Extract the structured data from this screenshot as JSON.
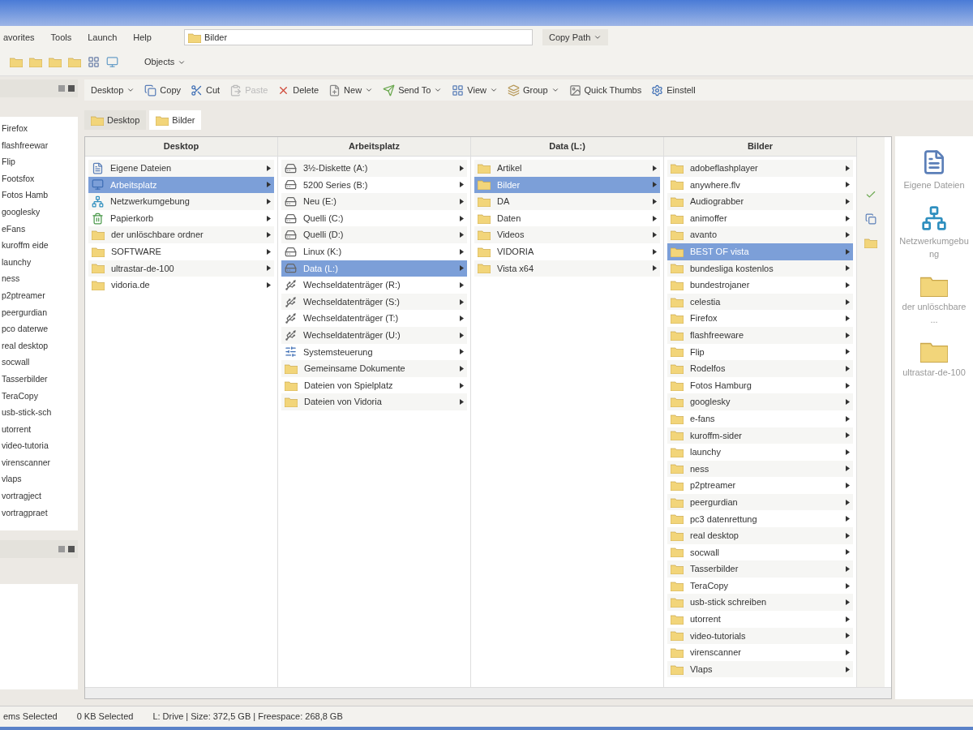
{
  "menu": [
    "avorites",
    "Tools",
    "Launch",
    "Help"
  ],
  "address": {
    "value": "Bilder"
  },
  "copy_path": "Copy Path",
  "toolbar": {
    "objects": "Objects"
  },
  "left_tree": [
    "Firefox",
    "flashfreewar",
    "Flip",
    "Footsfox",
    "Fotos Hamb",
    "googlesky",
    "eFans",
    "kuroffm eide",
    "launchy",
    "ness",
    "p2ptreamer",
    "peergurdian",
    "pco daterwe",
    "real desktop",
    "socwall",
    "Tasserbilder",
    "TeraCopy",
    "usb-stick-sch",
    "utorrent",
    "video-tutoria",
    "virenscanner",
    "vlaps",
    "vortragject",
    "vortragpraet"
  ],
  "actions": [
    {
      "label": "Desktop",
      "kind": "dropdown",
      "disabled": false
    },
    {
      "label": "Copy",
      "kind": "copy",
      "disabled": false
    },
    {
      "label": "Cut",
      "kind": "cut",
      "disabled": false
    },
    {
      "label": "Paste",
      "kind": "paste",
      "disabled": true
    },
    {
      "label": "Delete",
      "kind": "delete",
      "disabled": false
    },
    {
      "label": "New",
      "kind": "new",
      "disabled": false
    },
    {
      "label": "Send To",
      "kind": "send",
      "disabled": false
    },
    {
      "label": "View",
      "kind": "view",
      "disabled": false
    },
    {
      "label": "Group",
      "kind": "group",
      "disabled": false
    },
    {
      "label": "Quick Thumbs",
      "kind": "thumbs",
      "disabled": false
    },
    {
      "label": "Einstell",
      "kind": "settings",
      "disabled": false
    }
  ],
  "tabs": [
    {
      "label": "Desktop",
      "selected": false
    },
    {
      "label": "Bilder",
      "selected": true
    }
  ],
  "columns": [
    {
      "title": "Desktop",
      "items": [
        {
          "label": "Eigene Dateien",
          "kind": "documents",
          "selected": false
        },
        {
          "label": "Arbeitsplatz",
          "kind": "computer",
          "selected": true
        },
        {
          "label": "Netzwerkumgebung",
          "kind": "network",
          "selected": false
        },
        {
          "label": "Papierkorb",
          "kind": "trash",
          "selected": false
        },
        {
          "label": "der unlöschbare ordner",
          "kind": "folder",
          "selected": false
        },
        {
          "label": "SOFTWARE",
          "kind": "folder",
          "selected": false
        },
        {
          "label": "ultrastar-de-100",
          "kind": "folder",
          "selected": false
        },
        {
          "label": "vidoria.de",
          "kind": "folder",
          "selected": false
        }
      ]
    },
    {
      "title": "Arbeitsplatz",
      "items": [
        {
          "label": "3½-Diskette (A:)",
          "kind": "drive",
          "selected": false
        },
        {
          "label": "5200 Series (B:)",
          "kind": "drive",
          "selected": false
        },
        {
          "label": "Neu (E:)",
          "kind": "drive",
          "selected": false
        },
        {
          "label": "Quelli (C:)",
          "kind": "drive",
          "selected": false
        },
        {
          "label": "Quelli (D:)",
          "kind": "drive",
          "selected": false
        },
        {
          "label": "Linux (K:)",
          "kind": "drive",
          "selected": false
        },
        {
          "label": "Data (L:)",
          "kind": "drive",
          "selected": true
        },
        {
          "label": "Wechseldatenträger (R:)",
          "kind": "removable",
          "selected": false
        },
        {
          "label": "Wechseldatenträger (S:)",
          "kind": "removable",
          "selected": false
        },
        {
          "label": "Wechseldatenträger (T:)",
          "kind": "removable",
          "selected": false
        },
        {
          "label": "Wechseldatenträger (U:)",
          "kind": "removable",
          "selected": false
        },
        {
          "label": "Systemsteuerung",
          "kind": "control",
          "selected": false
        },
        {
          "label": "Gemeinsame Dokumente",
          "kind": "folder",
          "selected": false
        },
        {
          "label": "Dateien von Spielplatz",
          "kind": "folder",
          "selected": false
        },
        {
          "label": "Dateien von Vidoria",
          "kind": "folder",
          "selected": false
        }
      ]
    },
    {
      "title": "Data (L:)",
      "items": [
        {
          "label": "Artikel",
          "kind": "folder",
          "selected": false
        },
        {
          "label": "Bilder",
          "kind": "folder",
          "selected": true
        },
        {
          "label": "DA",
          "kind": "folder",
          "selected": false
        },
        {
          "label": "Daten",
          "kind": "folder",
          "selected": false
        },
        {
          "label": "Videos",
          "kind": "folder",
          "selected": false
        },
        {
          "label": "VIDORIA",
          "kind": "folder",
          "selected": false
        },
        {
          "label": "Vista x64",
          "kind": "folder",
          "selected": false
        }
      ]
    },
    {
      "title": "Bilder",
      "items": [
        {
          "label": "adobeflashplayer",
          "kind": "folder",
          "selected": false
        },
        {
          "label": "anywhere.flv",
          "kind": "folder",
          "selected": false
        },
        {
          "label": "Audiograbber",
          "kind": "folder",
          "selected": false
        },
        {
          "label": "animoffer",
          "kind": "folder",
          "selected": false
        },
        {
          "label": "avanto",
          "kind": "folder",
          "selected": false
        },
        {
          "label": "BEST OF vista",
          "kind": "folder",
          "selected": true
        },
        {
          "label": "bundesliga kostenlos",
          "kind": "folder",
          "selected": false
        },
        {
          "label": "bundestrojaner",
          "kind": "folder",
          "selected": false
        },
        {
          "label": "celestia",
          "kind": "folder",
          "selected": false
        },
        {
          "label": "Firefox",
          "kind": "folder",
          "selected": false
        },
        {
          "label": "flashfreeware",
          "kind": "folder",
          "selected": false
        },
        {
          "label": "Flip",
          "kind": "folder",
          "selected": false
        },
        {
          "label": "Rodelfos",
          "kind": "folder",
          "selected": false
        },
        {
          "label": "Fotos Hamburg",
          "kind": "folder",
          "selected": false
        },
        {
          "label": "googlesky",
          "kind": "folder",
          "selected": false
        },
        {
          "label": "e-fans",
          "kind": "folder",
          "selected": false
        },
        {
          "label": "kuroffm-sider",
          "kind": "folder",
          "selected": false
        },
        {
          "label": "launchy",
          "kind": "folder",
          "selected": false
        },
        {
          "label": "ness",
          "kind": "folder",
          "selected": false
        },
        {
          "label": "p2ptreamer",
          "kind": "folder",
          "selected": false
        },
        {
          "label": "peergurdian",
          "kind": "folder",
          "selected": false
        },
        {
          "label": "pc3 datenrettung",
          "kind": "folder",
          "selected": false
        },
        {
          "label": "real desktop",
          "kind": "folder",
          "selected": false
        },
        {
          "label": "socwall",
          "kind": "folder",
          "selected": false
        },
        {
          "label": "Tasserbilder",
          "kind": "folder",
          "selected": false
        },
        {
          "label": "TeraCopy",
          "kind": "folder",
          "selected": false
        },
        {
          "label": "usb-stick schreiben",
          "kind": "folder",
          "selected": false
        },
        {
          "label": "utorrent",
          "kind": "folder",
          "selected": false
        },
        {
          "label": "video-tutorials",
          "kind": "folder",
          "selected": false
        },
        {
          "label": "virenscanner",
          "kind": "folder",
          "selected": false
        },
        {
          "label": "Vlaps",
          "kind": "folder",
          "selected": false
        }
      ]
    }
  ],
  "preview": [
    {
      "label": "Eigene Dateien",
      "kind": "documents"
    },
    {
      "label": "Netzwerkumgebung",
      "kind": "network"
    },
    {
      "label": "der unlöschbare ...",
      "kind": "folder"
    },
    {
      "label": "ultrastar-de-100",
      "kind": "folder"
    }
  ],
  "status_bar": [
    "ems Selected",
    "0 KB Selected",
    "L: Drive | Size: 372,5 GB | Freespace: 268,8 GB"
  ]
}
